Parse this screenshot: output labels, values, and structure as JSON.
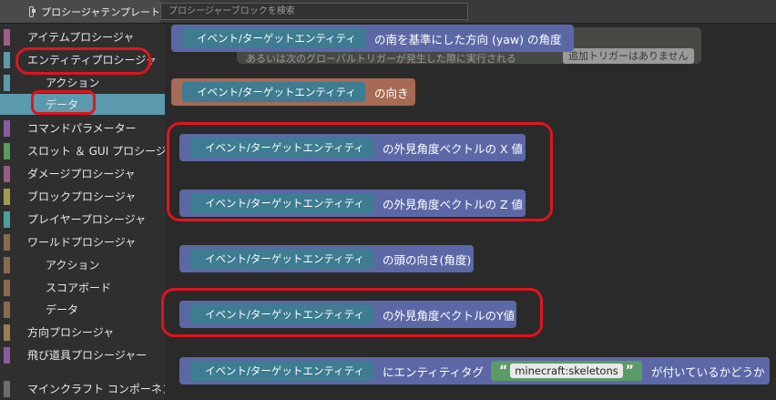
{
  "tab": {
    "label": "プロシージャテンプレート"
  },
  "search": {
    "placeholder": "プロシージャーブロックを検索"
  },
  "sidebar": {
    "items": [
      {
        "label": "アイテムプロシージャ",
        "color": "#a25d8a"
      },
      {
        "label": "エンティティプロシージャ",
        "color": "#5b9aad"
      },
      {
        "label": "アクション",
        "color": "#5b9aad"
      },
      {
        "label": "データ",
        "color": "#5b9aad"
      },
      {
        "label": "コマンドパラメーター",
        "color": "#8a5aa0"
      },
      {
        "label": "スロット ＆ GUI プロシージャ",
        "color": "#5c9b5a"
      },
      {
        "label": "ダメージプロシージャ",
        "color": "#9c5a86"
      },
      {
        "label": "ブロックプロシージャ",
        "color": "#a39a4f"
      },
      {
        "label": "プレイヤープロシージャ",
        "color": "#4f9f9b"
      },
      {
        "label": "ワールドプロシージャ",
        "color": "#8a6a4e"
      },
      {
        "label": "アクション",
        "color": "#8a6a4e"
      },
      {
        "label": "スコアボード",
        "color": "#8a6a4e"
      },
      {
        "label": "データ",
        "color": "#8a6a4e"
      },
      {
        "label": "方向プロシージャ",
        "color": "#9a8050"
      },
      {
        "label": "飛び道具プロシージャー",
        "color": "#8f5aa0"
      },
      {
        "label": "マインクラフト コンポーネント",
        "color": "#6d6d6d"
      }
    ]
  },
  "blocks": {
    "entity_label": "イベント/ターゲットエンティティ",
    "b1_suffix": "の南を基準にした方向 (yaw) の角度",
    "b2_suffix": "の向き",
    "b3_suffix": "の外見角度ベクトルの X 値",
    "b4_suffix": "の外見角度ベクトルの Z 値",
    "b5_suffix": "の頭の向き(角度)",
    "b6_suffix": "の外見角度ベクトルのY値",
    "b7_mid": "にエンティティタグ",
    "b7_string": "minecraft:skeletons",
    "b7_suffix": "が付いているかどうか",
    "quote_open": "“",
    "quote_close": "”"
  },
  "ghost": {
    "text": "あるいは次のグローバルトリガーが発生した際に実行される",
    "chip": "追加トリガーはありません"
  }
}
